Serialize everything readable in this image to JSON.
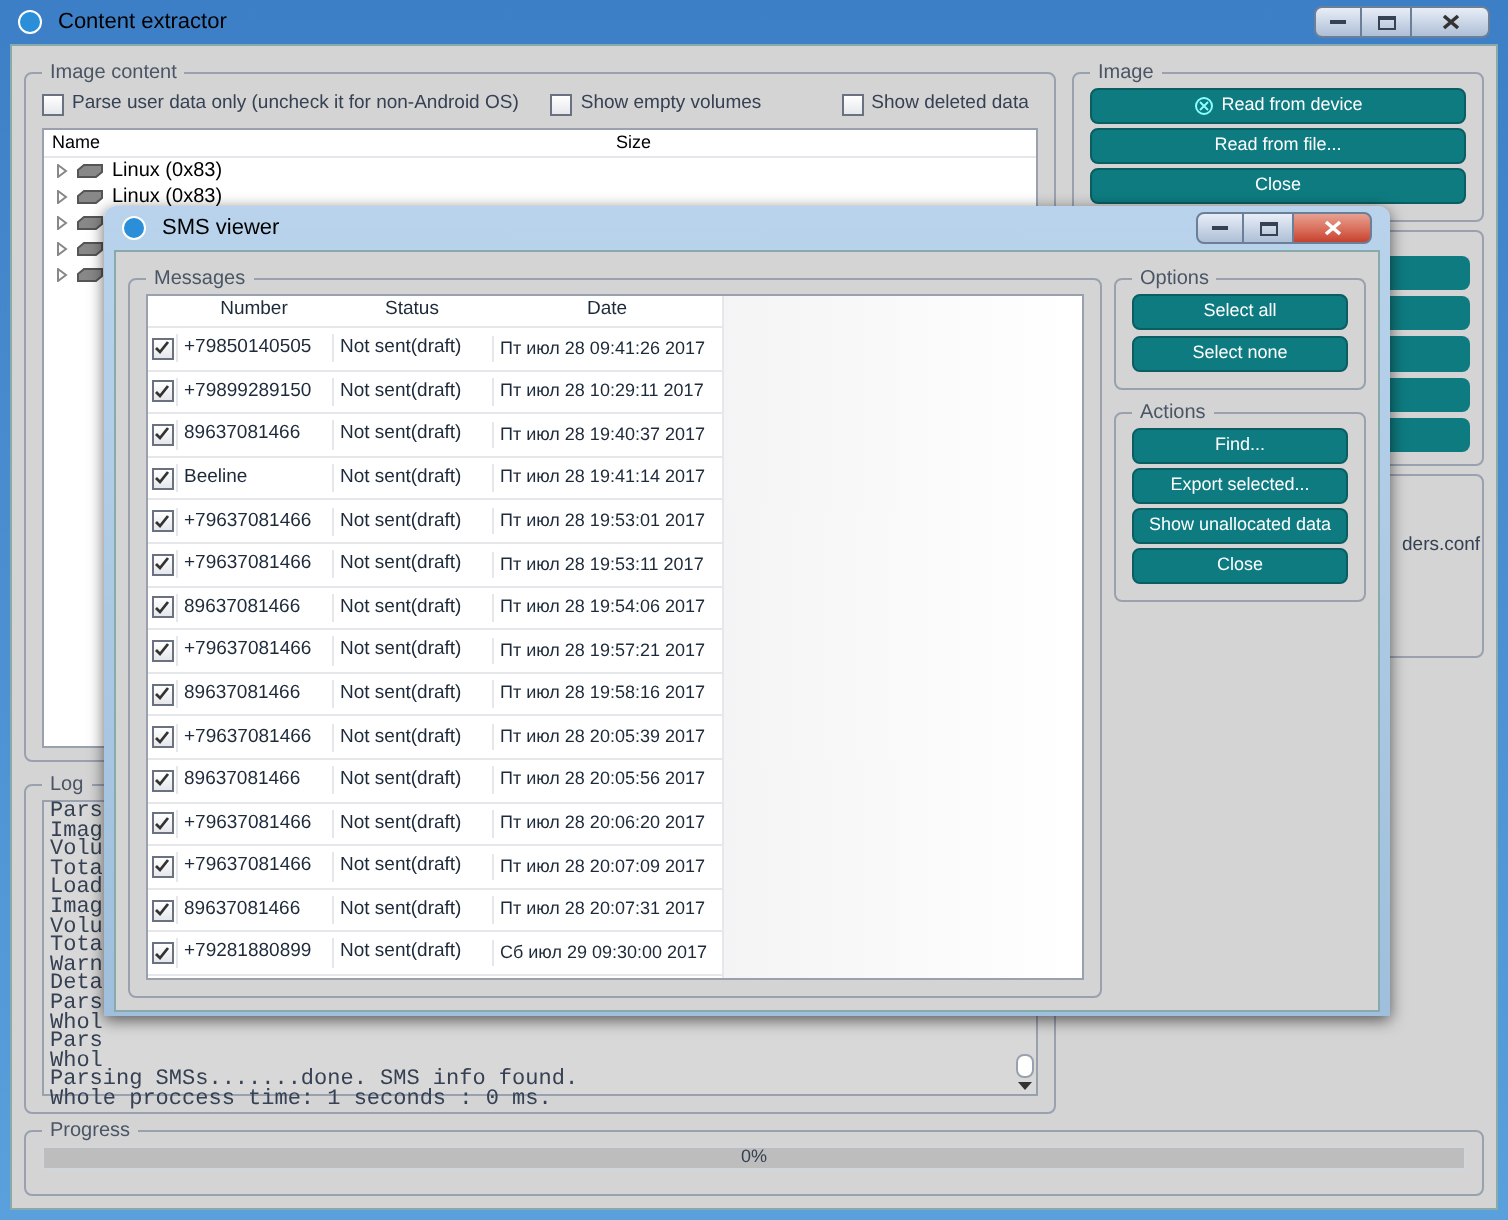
{
  "window": {
    "title": "Content extractor"
  },
  "image_content": {
    "title": "Image content",
    "options": [
      {
        "label": "Parse user data only (uncheck it for non-Android OS)",
        "checked": false
      },
      {
        "label": "Show empty volumes",
        "checked": false
      },
      {
        "label": "Show deleted data",
        "checked": false
      }
    ],
    "columns": [
      "Name",
      "Size"
    ],
    "tree": [
      {
        "label": "Linux (0x83)",
        "expanded": false
      },
      {
        "label": "Linux (0x83)",
        "expanded": false
      },
      {
        "expanded": false
      },
      {
        "expanded": false
      },
      {
        "expanded": false
      }
    ]
  },
  "log": {
    "title": "Log",
    "lines": [
      "Pars",
      "Imag",
      "Volu",
      "Tota",
      "Load",
      "Imag",
      "Volu",
      "Tota",
      "Warn",
      "Deta",
      "Pars",
      "Whol",
      "Pars",
      "Whol",
      "Parsing SMSs.......done. SMS info found.",
      "Whole proccess time: 1 seconds : 0 ms."
    ]
  },
  "image_group": {
    "title": "Image",
    "buttons": [
      {
        "label": "Read from device",
        "kind": "icon"
      },
      {
        "label": "Read from file...",
        "kind": "plain"
      },
      {
        "label": "Close",
        "kind": "plain"
      }
    ]
  },
  "side_text": "ders.conf",
  "progress": {
    "title": "Progress",
    "level": 0,
    "text": "0%"
  },
  "sms_viewer": {
    "title": "SMS viewer",
    "messages_title": "Messages",
    "columns": [
      "Number",
      "Status",
      "Date"
    ],
    "rows": [
      {
        "checked": true,
        "number": "+79850140505",
        "status": "Not sent(draft)",
        "date": "Пт июл 28 09:41:26 2017"
      },
      {
        "checked": true,
        "number": "+79899289150",
        "status": "Not sent(draft)",
        "date": "Пт июл 28 10:29:11 2017"
      },
      {
        "checked": true,
        "number": "89637081466",
        "status": "Not sent(draft)",
        "date": "Пт июл 28 19:40:37 2017"
      },
      {
        "checked": true,
        "number": "Beeline",
        "status": "Not sent(draft)",
        "date": "Пт июл 28 19:41:14 2017"
      },
      {
        "checked": true,
        "number": "+79637081466",
        "status": "Not sent(draft)",
        "date": "Пт июл 28 19:53:01 2017"
      },
      {
        "checked": true,
        "number": "+79637081466",
        "status": "Not sent(draft)",
        "date": "Пт июл 28 19:53:11 2017"
      },
      {
        "checked": true,
        "number": "89637081466",
        "status": "Not sent(draft)",
        "date": "Пт июл 28 19:54:06 2017"
      },
      {
        "checked": true,
        "number": "+79637081466",
        "status": "Not sent(draft)",
        "date": "Пт июл 28 19:57:21 2017"
      },
      {
        "checked": true,
        "number": "89637081466",
        "status": "Not sent(draft)",
        "date": "Пт июл 28 19:58:16 2017"
      },
      {
        "checked": true,
        "number": "+79637081466",
        "status": "Not sent(draft)",
        "date": "Пт июл 28 20:05:39 2017"
      },
      {
        "checked": true,
        "number": "89637081466",
        "status": "Not sent(draft)",
        "date": "Пт июл 28 20:05:56 2017"
      },
      {
        "checked": true,
        "number": "+79637081466",
        "status": "Not sent(draft)",
        "date": "Пт июл 28 20:06:20 2017"
      },
      {
        "checked": true,
        "number": "+79637081466",
        "status": "Not sent(draft)",
        "date": "Пт июл 28 20:07:09 2017"
      },
      {
        "checked": true,
        "number": "89637081466",
        "status": "Not sent(draft)",
        "date": "Пт июл 28 20:07:31 2017"
      },
      {
        "checked": true,
        "number": "+79281880899",
        "status": "Not sent(draft)",
        "date": "Сб июл 29 09:30:00 2017"
      }
    ],
    "options_title": "Options",
    "options_buttons": [
      "Select all",
      "Select none"
    ],
    "actions_title": "Actions",
    "actions_buttons": [
      "Find...",
      "Export selected...",
      "Show unallocated data",
      "Close"
    ]
  }
}
